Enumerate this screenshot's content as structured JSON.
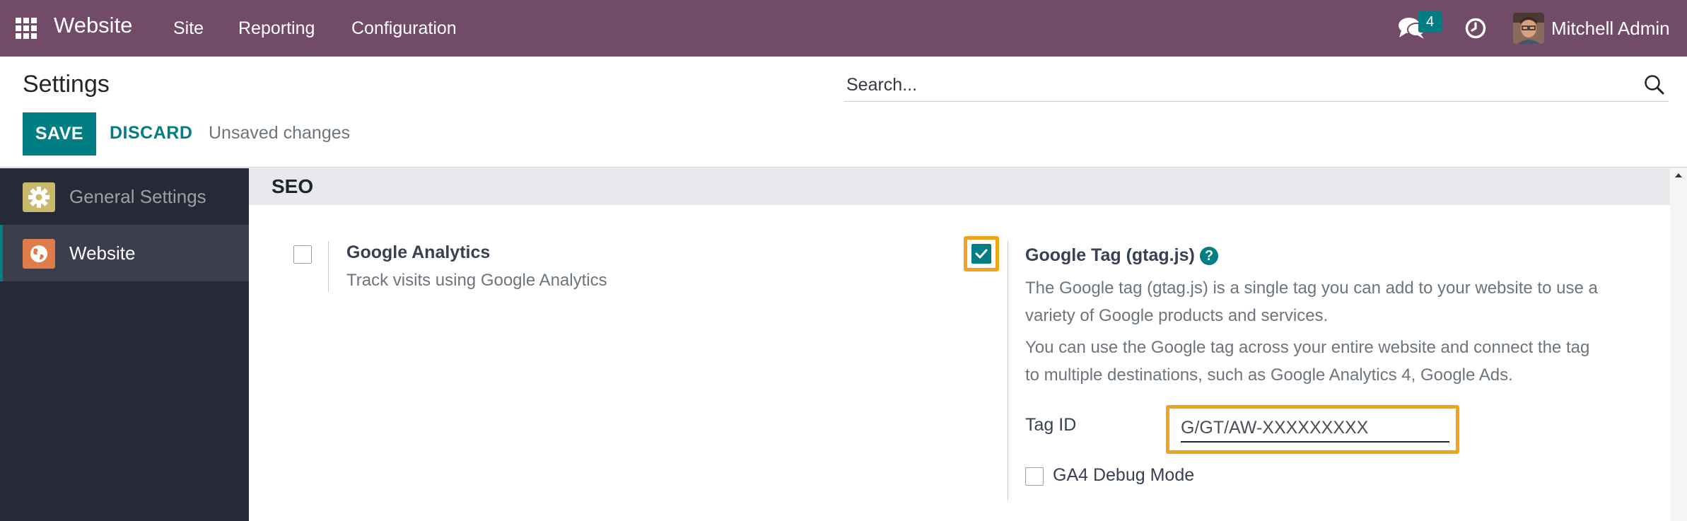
{
  "navbar": {
    "brand": "Website",
    "menu": [
      "Site",
      "Reporting",
      "Configuration"
    ],
    "message_count": "4",
    "user_name": "Mitchell Admin"
  },
  "control_panel": {
    "title": "Settings",
    "search_placeholder": "Search...",
    "save_label": "SAVE",
    "discard_label": "DISCARD",
    "status": "Unsaved changes"
  },
  "sidebar": {
    "items": [
      {
        "label": "General Settings",
        "icon": "gear-icon",
        "active": false
      },
      {
        "label": "Website",
        "icon": "globe-icon",
        "active": true
      }
    ]
  },
  "section": {
    "title": "SEO",
    "google_analytics": {
      "title": "Google Analytics",
      "description": "Track visits using Google Analytics",
      "checked": false
    },
    "google_tag": {
      "title": "Google Tag (gtag.js)",
      "checked": true,
      "description_1": "The Google tag (gtag.js) is a single tag you can add to your website to use a variety of Google products and services.",
      "description_2": "You can use the Google tag across your entire website and connect the tag to multiple destinations, such as Google Analytics 4, Google Ads.",
      "tag_id_label": "Tag ID",
      "tag_id_placeholder": "G/GT/AW-XXXXXXXXX",
      "debug_label": "GA4 Debug Mode",
      "debug_checked": false
    }
  },
  "colors": {
    "navbar": "#714b67",
    "accent": "#017e84",
    "highlight": "#f3a21b",
    "sidebar": "#262a36"
  }
}
